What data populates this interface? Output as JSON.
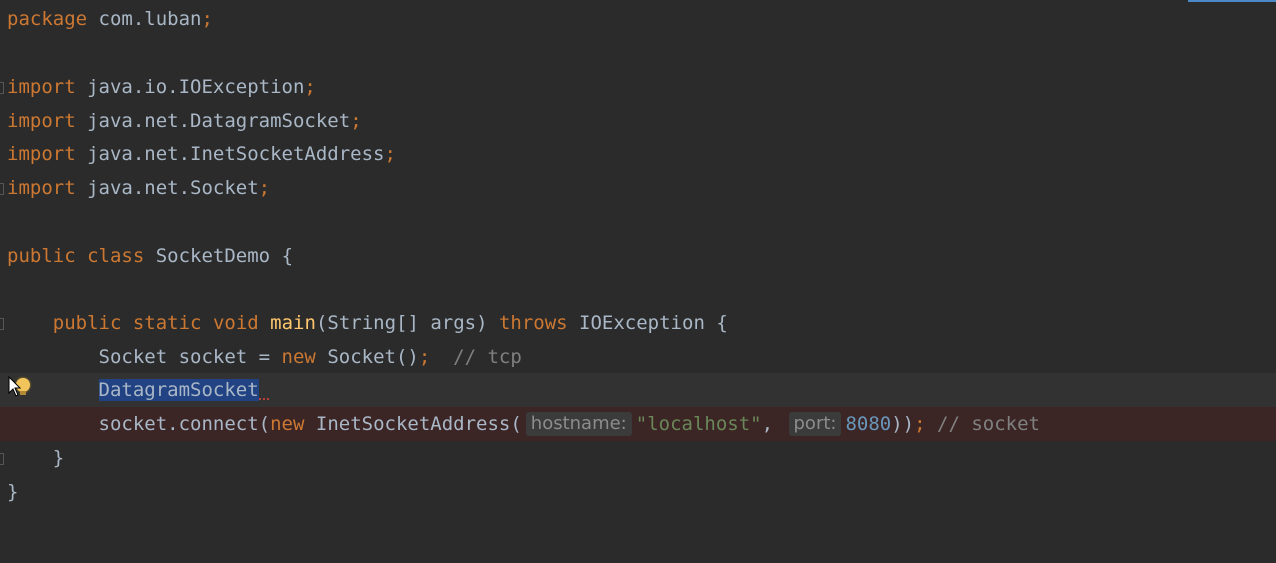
{
  "lines": {
    "l1": {
      "kw": "package",
      "rest": " com.luban",
      "semi": ";"
    },
    "l3": {
      "kw": "import",
      "rest": " java.io.IOException",
      "semi": ";"
    },
    "l4": {
      "kw": "import",
      "rest": " java.net.DatagramSocket",
      "semi": ";"
    },
    "l5": {
      "kw": "import",
      "rest": " java.net.InetSocketAddress",
      "semi": ";"
    },
    "l6": {
      "kw": "import",
      "rest": " java.net.Socket",
      "semi": ";"
    },
    "l8": {
      "kw1": "public",
      "kw2": "class",
      "name": " SocketDemo {"
    },
    "l10": {
      "kw1": "public",
      "kw2": "static",
      "kw3": "void",
      "fn": "main",
      "params": "(String[] args) ",
      "kw4": "throws",
      "rest": " IOException {"
    },
    "l11": {
      "pre": "Socket socket = ",
      "kw": "new",
      "post": " Socket()",
      "semi": ";",
      "comment": "// tcp"
    },
    "l12": {
      "selected": "DatagramSocket"
    },
    "l13": {
      "pre": "socket.connect(",
      "kw": "new",
      "mid": " InetSocketAddress(",
      "hint1": "hostname:",
      "str": "\"localhost\"",
      "comma": ",",
      "hint2": "port:",
      "num": "8080",
      "close": "))",
      "semi": ";",
      "comment": "// socket"
    },
    "l14": {
      "brace": "}"
    },
    "l15": {
      "brace": "}"
    }
  },
  "colors": {
    "background": "#2b2b2b",
    "keyword": "#cc7832",
    "string": "#6a8759",
    "number": "#6897bb",
    "comment": "#808080",
    "method": "#ffc66d",
    "selection": "#214283",
    "error_line": "#3b2525"
  },
  "icons": {
    "bulb": "intention-bulb-icon",
    "cursor": "mouse-pointer-icon"
  }
}
